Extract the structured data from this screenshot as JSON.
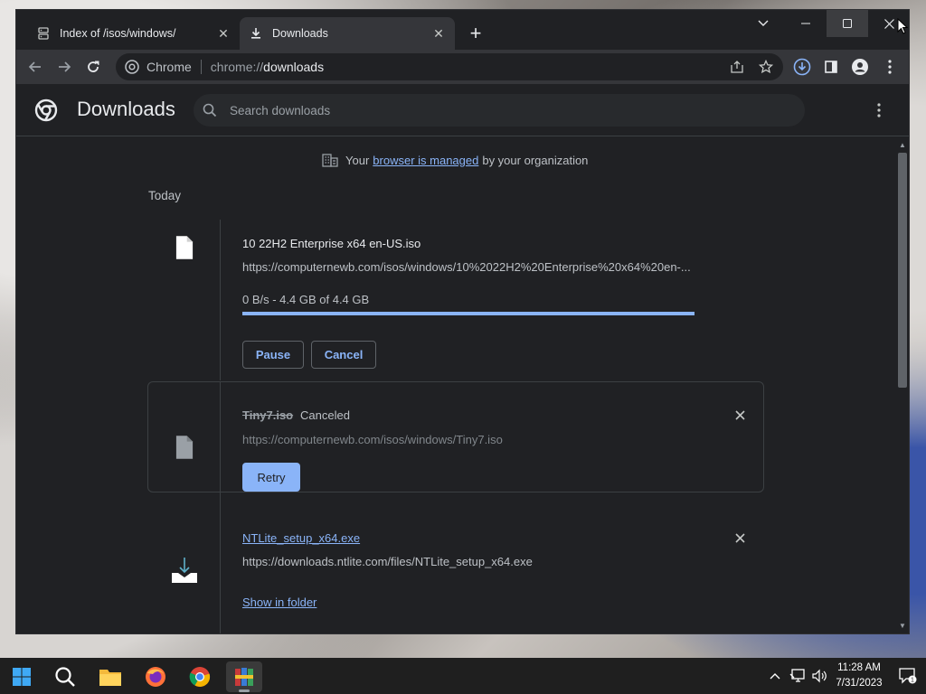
{
  "browser": {
    "tabs": [
      {
        "title": "Index of /isos/windows/",
        "icon": "server-icon",
        "active": false
      },
      {
        "title": "Downloads",
        "icon": "download-icon",
        "active": true
      }
    ],
    "omnibox": {
      "chip_label": "Chrome",
      "url_scheme": "chrome://",
      "url_host": "downloads"
    }
  },
  "downloads_page": {
    "title": "Downloads",
    "search_placeholder": "Search downloads",
    "managed_notice": {
      "prefix": "Your",
      "link": "browser is managed",
      "suffix": "by your organization"
    },
    "section_label": "Today",
    "items": [
      {
        "filename": "10 22H2 Enterprise x64 en-US.iso",
        "url": "https://computernewb.com/isos/windows/10%2022H2%20Enterprise%20x64%20en-...",
        "status": "0 B/s - 4.4 GB of 4.4 GB",
        "progress_percent": 100,
        "actions": [
          "Pause",
          "Cancel"
        ]
      },
      {
        "filename": "Tiny7.iso",
        "state": "Canceled",
        "url": "https://computernewb.com/isos/windows/Tiny7.iso",
        "action": "Retry"
      },
      {
        "filename": "NTLite_setup_x64.exe",
        "url": "https://downloads.ntlite.com/files/NTLite_setup_x64.exe",
        "action": "Show in folder"
      }
    ]
  },
  "taskbar": {
    "apps": [
      "start-icon",
      "search-icon",
      "file-explorer-icon",
      "firefox-icon",
      "chrome-icon",
      "winrar-icon"
    ],
    "time": "11:28 AM",
    "date": "7/31/2023",
    "notification_count": "1"
  },
  "colors": {
    "accent": "#8ab4f8",
    "page_bg": "#202124",
    "toolbar_bg": "#35363a"
  }
}
